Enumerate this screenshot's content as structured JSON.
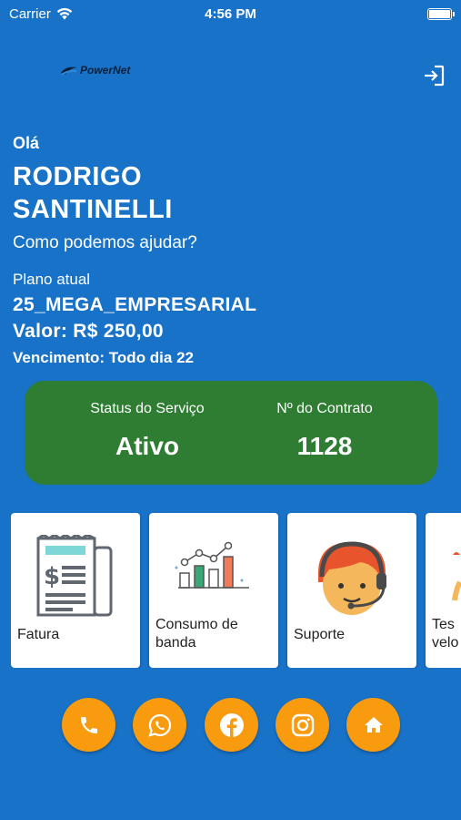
{
  "status_bar": {
    "carrier": "Carrier",
    "time": "4:56 PM"
  },
  "header": {
    "logo_text": "PowerNet",
    "logout_icon": "logout-icon"
  },
  "user": {
    "greeting": "Olá",
    "name": "RODRIGO SANTINELLI",
    "help_text": "Como podemos ajudar?"
  },
  "plan": {
    "label": "Plano atual",
    "name": "25_MEGA_EMPRESARIAL",
    "value": "Valor: R$ 250,00",
    "due": "Vencimento: Todo dia 22"
  },
  "service": {
    "status_label": "Status do Serviço",
    "status_value": "Ativo",
    "contract_label": "Nº do Contrato",
    "contract_value": "1128",
    "card_color": "#2e7d32"
  },
  "tiles": [
    {
      "label": "Fatura",
      "icon": "invoice-icon"
    },
    {
      "label": "Consumo de banda",
      "icon": "bandwidth-chart-icon"
    },
    {
      "label": "Suporte",
      "icon": "support-agent-icon"
    },
    {
      "label": "Tes velo",
      "icon": "speed-test-icon"
    }
  ],
  "actions": [
    {
      "icon": "phone-icon"
    },
    {
      "icon": "whatsapp-icon"
    },
    {
      "icon": "facebook-icon"
    },
    {
      "icon": "instagram-icon"
    },
    {
      "icon": "home-icon"
    }
  ],
  "colors": {
    "background": "#1872c8",
    "accent": "#f99b0e",
    "status_green": "#2e7d32"
  }
}
